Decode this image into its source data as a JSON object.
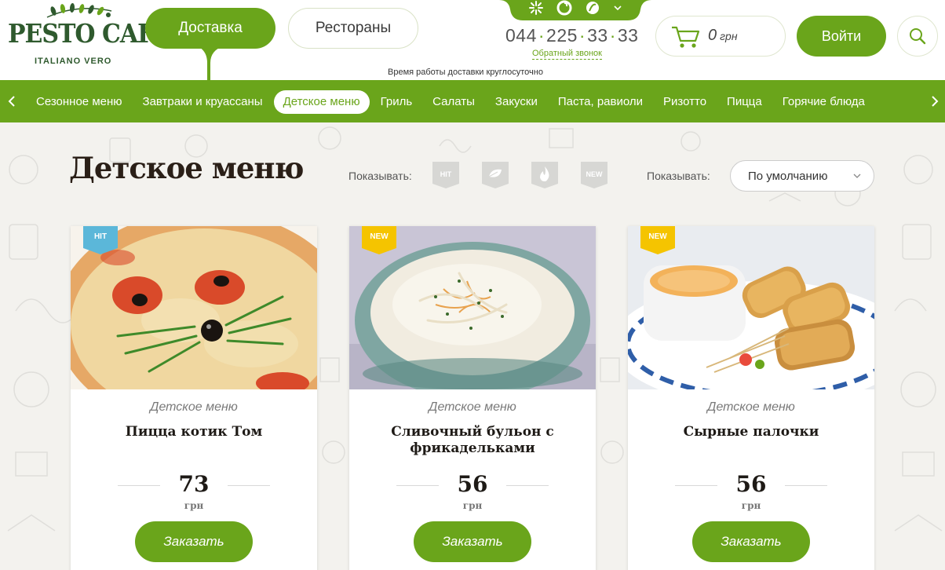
{
  "header": {
    "logo_title": "PESTO CAFE",
    "logo_subtitle": "ITALIANO VERO",
    "delivery_label": "Доставка",
    "restaurants_label": "Рестораны",
    "phone": {
      "part1": "044",
      "part2": "225",
      "part3": "33",
      "part4": "33",
      "operator_icons": [
        "kyivstar-icon",
        "vodafone-icon",
        "lifecell-icon",
        "chevron-down-icon"
      ]
    },
    "callback_label": "Обратный звонок",
    "delivery_hours": "Время работы доставки круглосуточно",
    "cart": {
      "amount": "0",
      "currency": "грн"
    },
    "login_label": "Войти"
  },
  "nav": {
    "items": [
      {
        "label": "Сезонное меню",
        "active": false
      },
      {
        "label": "Завтраки и круассаны",
        "active": false
      },
      {
        "label": "Детское меню",
        "active": true
      },
      {
        "label": "Гриль",
        "active": false
      },
      {
        "label": "Салаты",
        "active": false
      },
      {
        "label": "Закуски",
        "active": false
      },
      {
        "label": "Паста, равиоли",
        "active": false
      },
      {
        "label": "Ризотто",
        "active": false
      },
      {
        "label": "Пицца",
        "active": false
      },
      {
        "label": "Горячие блюда",
        "active": false
      }
    ]
  },
  "main": {
    "title": "Детское меню",
    "filter_label": "Показывать:",
    "filters": [
      {
        "label": "HIT"
      },
      {
        "label": ""
      },
      {
        "label": ""
      },
      {
        "label": "NEW"
      }
    ],
    "sort_label": "Показывать:",
    "sort_value": "По умолчанию"
  },
  "products": [
    {
      "badge": "HIT",
      "badge_color": "#5bb7d9",
      "category": "Детское меню",
      "name": "Пицца котик Том",
      "price": "73",
      "currency": "грн",
      "order_label": "Заказать"
    },
    {
      "badge": "NEW",
      "badge_color": "#f5c400",
      "category": "Детское меню",
      "name": "Сливочный бульон с фрикадельками",
      "price": "56",
      "currency": "грн",
      "order_label": "Заказать"
    },
    {
      "badge": "NEW",
      "badge_color": "#f5c400",
      "category": "Детское меню",
      "name": "Сырные палочки",
      "price": "56",
      "currency": "грн",
      "order_label": "Заказать"
    }
  ],
  "colors": {
    "brand_green": "#6aa51b",
    "logo_green": "#2f5a2e",
    "page_bg": "#f3f2ee"
  }
}
